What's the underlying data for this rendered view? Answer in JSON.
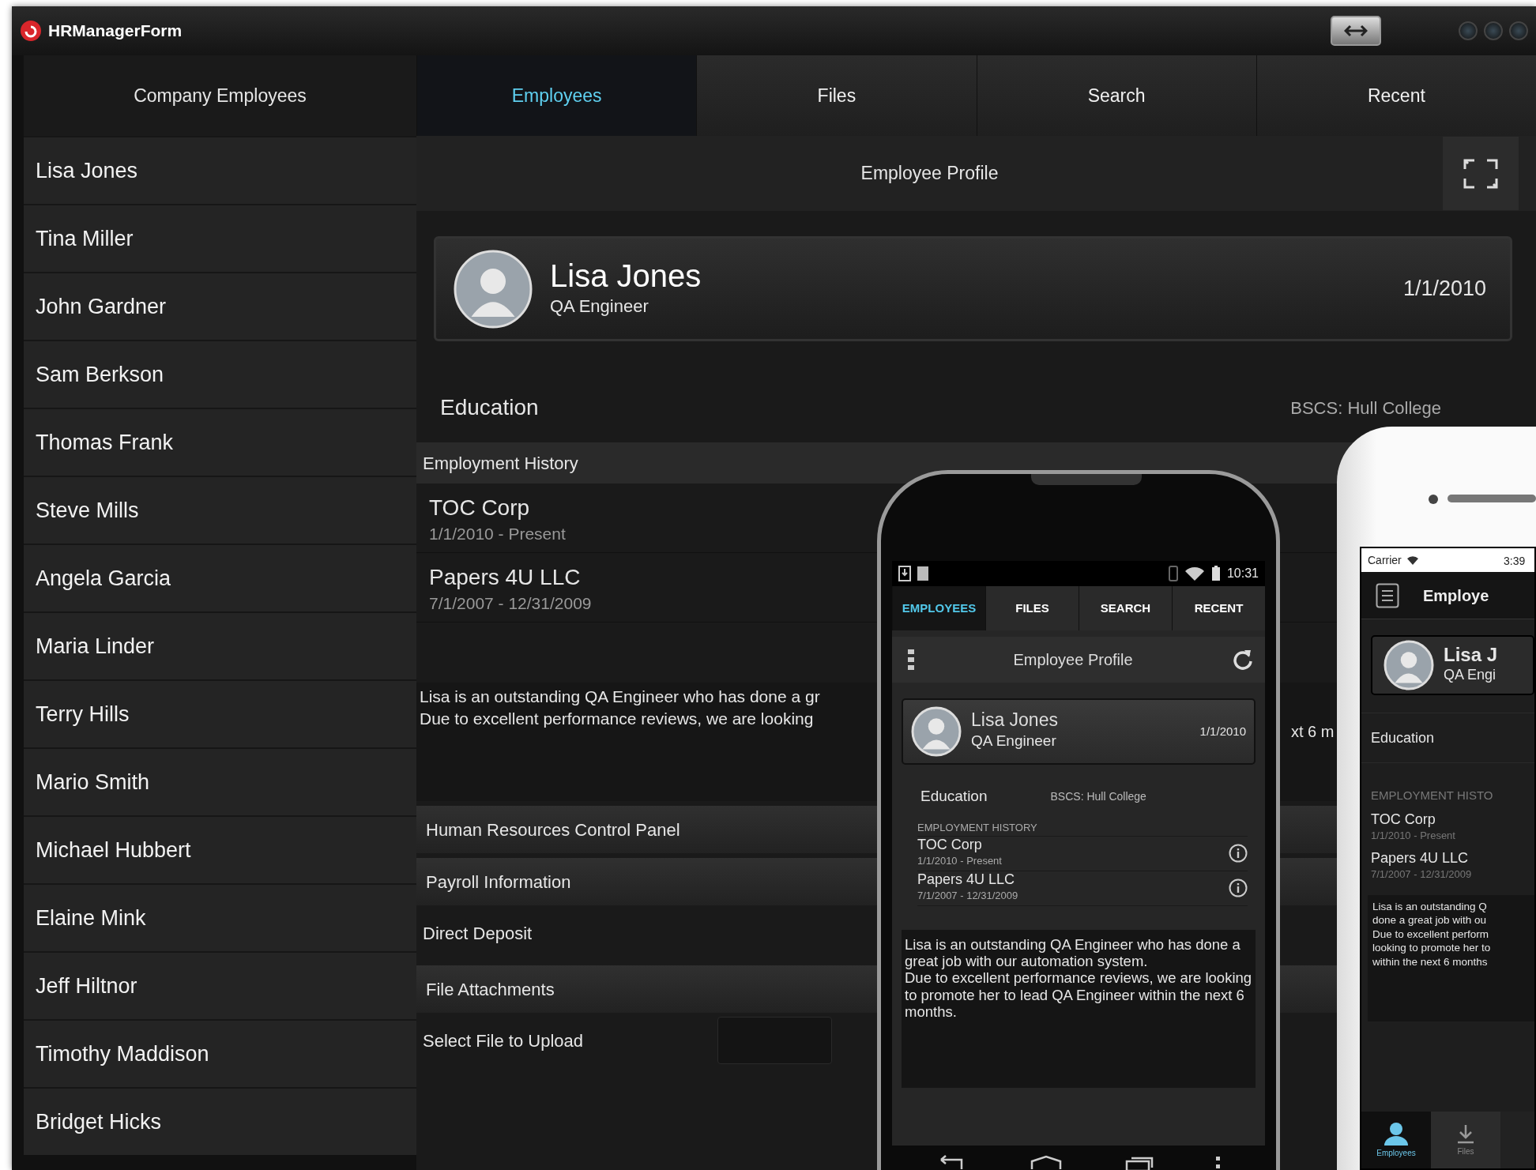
{
  "window": {
    "title": "HRManagerForm"
  },
  "sidebar": {
    "title": "Company Employees",
    "items": [
      "Lisa Jones",
      "Tina Miller",
      "John Gardner",
      "Sam Berkson",
      "Thomas Frank",
      "Steve Mills",
      "Angela Garcia",
      "Maria Linder",
      "Terry Hills",
      "Mario Smith",
      "Michael Hubbert",
      "Elaine Mink",
      "Jeff Hiltnor",
      "Timothy Maddison",
      "Bridget Hicks"
    ]
  },
  "tabs": [
    {
      "label": "Employees",
      "selected": true
    },
    {
      "label": "Files",
      "selected": false
    },
    {
      "label": "Search",
      "selected": false
    },
    {
      "label": "Recent",
      "selected": false
    }
  ],
  "profile": {
    "title": "Employee Profile",
    "name": "Lisa Jones",
    "job_title": "QA Engineer",
    "date": "1/1/2010",
    "education_label": "Education",
    "education": "BSCS: Hull College",
    "history_title": "Employment History",
    "history": [
      {
        "company": "TOC Corp",
        "dates": "1/1/2010 - Present"
      },
      {
        "company": "Papers 4U LLC",
        "dates": "7/1/2007 - 12/31/2009"
      }
    ],
    "description_lines": [
      "Lisa is an outstanding QA Engineer who has done a gr",
      "Due to excellent performance reviews, we are looking"
    ],
    "description_fragment": "xt 6 m"
  },
  "control_panel": {
    "title": "Human Resources Control Panel",
    "sections": [
      {
        "title": "Payroll Information",
        "fields": [
          {
            "label": "Direct Deposit",
            "kind": "plain"
          }
        ]
      },
      {
        "title": "File Attachments",
        "fields": [
          {
            "label": "Select File to Upload",
            "kind": "file"
          }
        ]
      }
    ]
  },
  "android": {
    "time": "10:31",
    "tabs": [
      {
        "label": "EMPLOYEES",
        "selected": true
      },
      {
        "label": "FILES",
        "selected": false
      },
      {
        "label": "SEARCH",
        "selected": false
      },
      {
        "label": "RECENT",
        "selected": false
      }
    ],
    "header": "Employee Profile",
    "name": "Lisa Jones",
    "job_title": "QA Engineer",
    "date": "1/1/2010",
    "education_label": "Education",
    "education": "BSCS: Hull College",
    "history_title": "EMPLOYMENT HISTORY",
    "history": [
      {
        "company": "TOC Corp",
        "dates": "1/1/2010 - Present"
      },
      {
        "company": "Papers 4U LLC",
        "dates": "7/1/2007 - 12/31/2009"
      }
    ],
    "description": [
      "Lisa is an outstanding QA Engineer who has done a great job with our automation system.",
      "Due to excellent performance reviews, we are looking to promote her to lead QA Engineer within the next 6 months."
    ]
  },
  "iphone": {
    "carrier": "Carrier",
    "time": "3:39",
    "header": "Employe",
    "name": "Lisa J",
    "job_title": "QA Engi",
    "education_label": "Education",
    "history_title": "EMPLOYMENT HISTO",
    "history": [
      {
        "company": "TOC Corp",
        "dates": "1/1/2010 - Present"
      },
      {
        "company": "Papers 4U LLC",
        "dates": "7/1/2007 - 12/31/2009"
      }
    ],
    "description_lines": [
      "Lisa is an outstanding Q",
      "done a great job with ou",
      "Due to excellent perform",
      "looking to promote her to",
      "within the next 6 months"
    ],
    "tabs": [
      {
        "label": "Employees",
        "selected": true
      },
      {
        "label": "Files",
        "selected": false
      }
    ]
  }
}
